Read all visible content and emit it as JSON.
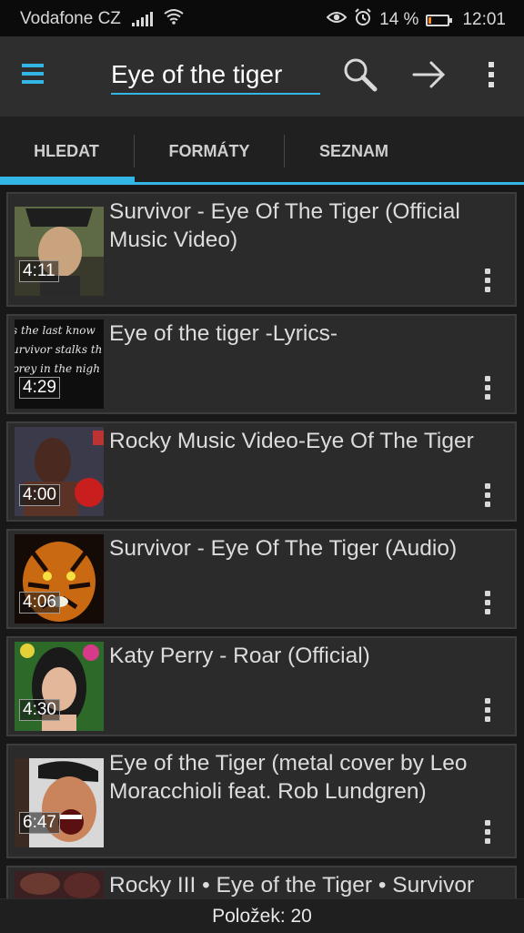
{
  "status": {
    "carrier": "Vodafone CZ",
    "battery_percent": "14 %",
    "battery_level": 0.14,
    "time": "12:01",
    "icons": [
      "signal-icon",
      "wifi-icon",
      "eye-icon",
      "alarm-icon",
      "battery-icon"
    ]
  },
  "toolbar": {
    "search_value": "Eye of the tiger",
    "icons": [
      "menu-icon",
      "search-icon",
      "go-arrow-icon",
      "overflow-menu-icon"
    ],
    "accent": "#33b5e5"
  },
  "tabs": [
    {
      "label": "HLEDAT",
      "active": true
    },
    {
      "label": "FORMÁTY",
      "active": false
    },
    {
      "label": "SEZNAM",
      "active": false
    }
  ],
  "results": [
    {
      "title": "Survivor - Eye Of The Tiger (Official Music Video)",
      "duration": "4:11"
    },
    {
      "title": "Eye of the tiger -Lyrics-",
      "duration": "4:29",
      "thumb_text": [
        "s the last know",
        "urvivor stalks th",
        "prey in the nigh"
      ]
    },
    {
      "title": "Rocky Music Video-Eye Of The Tiger",
      "duration": "4:00"
    },
    {
      "title": "Survivor - Eye Of The Tiger (Audio)",
      "duration": "4:06"
    },
    {
      "title": "Katy Perry - Roar (Official)",
      "duration": "4:30"
    },
    {
      "title": "Eye of the Tiger (metal cover by Leo Moracchioli feat. Rob Lundgren)",
      "duration": "6:47"
    },
    {
      "title": "Rocky III • Eye of the Tiger • Survivor",
      "duration": ""
    }
  ],
  "footer": {
    "count_label": "Položek: 20"
  }
}
